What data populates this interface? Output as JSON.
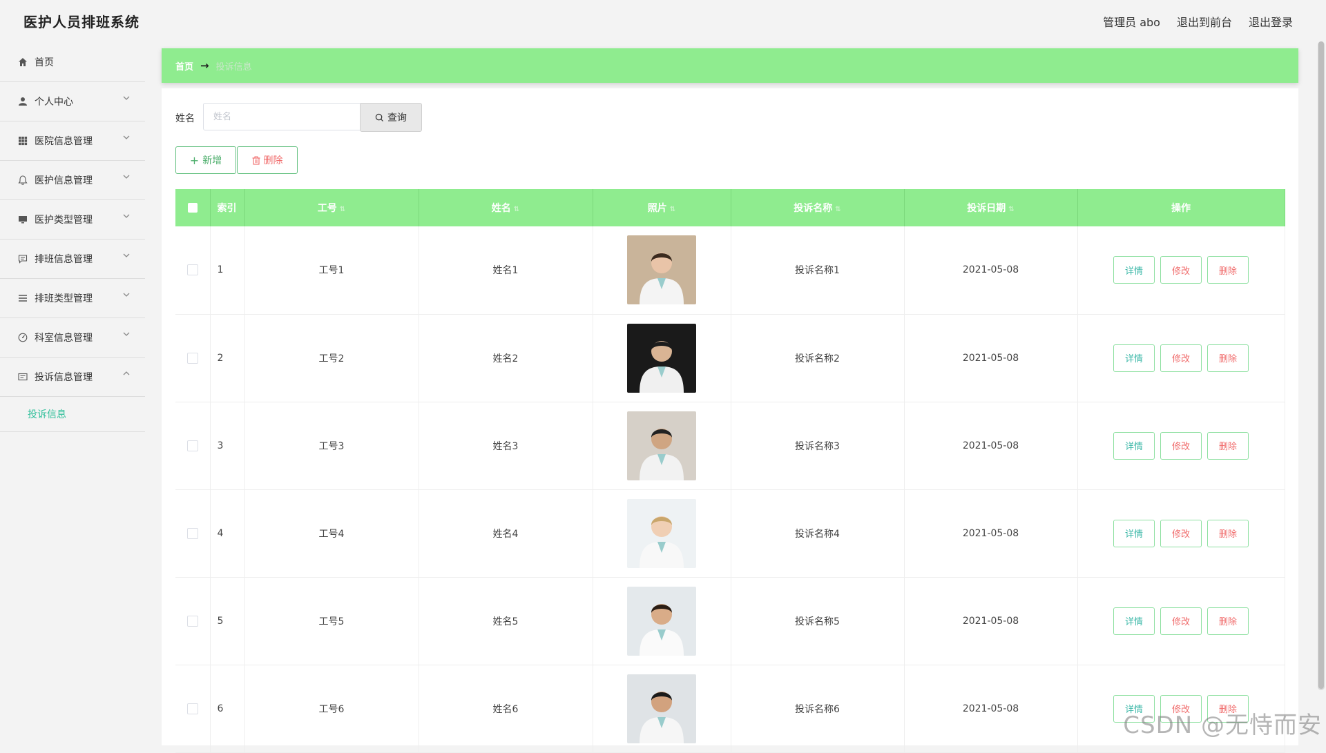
{
  "app": {
    "title": "医护人员排班系统",
    "top_links": [
      "管理员 abo",
      "退出到前台",
      "退出登录"
    ]
  },
  "sidebar": {
    "items": [
      {
        "label": "首页",
        "icon": "home-icon",
        "expandable": false
      },
      {
        "label": "个人中心",
        "icon": "user-icon",
        "expandable": true
      },
      {
        "label": "医院信息管理",
        "icon": "grid-icon",
        "expandable": true
      },
      {
        "label": "医护信息管理",
        "icon": "bell-icon",
        "expandable": true
      },
      {
        "label": "医护类型管理",
        "icon": "monitor-icon",
        "expandable": true
      },
      {
        "label": "排班信息管理",
        "icon": "chat-icon",
        "expandable": true
      },
      {
        "label": "排班类型管理",
        "icon": "list-icon",
        "expandable": true
      },
      {
        "label": "科室信息管理",
        "icon": "dashboard-icon",
        "expandable": true
      },
      {
        "label": "投诉信息管理",
        "icon": "card-icon",
        "expandable": true,
        "expanded": true
      }
    ],
    "submenu": {
      "label": "投诉信息"
    }
  },
  "breadcrumb": {
    "home": "首页",
    "current": "投诉信息"
  },
  "search": {
    "label": "姓名",
    "placeholder": "姓名",
    "value": "",
    "query_label": "查询"
  },
  "actions": {
    "add_label": "新增",
    "delete_label": "删除"
  },
  "table": {
    "columns": [
      "索引",
      "工号",
      "姓名",
      "照片",
      "投诉名称",
      "投诉日期",
      "操作"
    ],
    "sortable": [
      false,
      true,
      true,
      true,
      true,
      true,
      false
    ],
    "row_actions": [
      "详情",
      "修改",
      "删除"
    ],
    "rows": [
      {
        "index": "1",
        "job_no": "工号1",
        "name": "姓名1",
        "photo": "doctor-photo-1",
        "complaint": "投诉名称1",
        "date": "2021-05-08"
      },
      {
        "index": "2",
        "job_no": "工号2",
        "name": "姓名2",
        "photo": "doctor-photo-2",
        "complaint": "投诉名称2",
        "date": "2021-05-08"
      },
      {
        "index": "3",
        "job_no": "工号3",
        "name": "姓名3",
        "photo": "doctor-photo-3",
        "complaint": "投诉名称3",
        "date": "2021-05-08"
      },
      {
        "index": "4",
        "job_no": "工号4",
        "name": "姓名4",
        "photo": "doctor-photo-4",
        "complaint": "投诉名称4",
        "date": "2021-05-08"
      },
      {
        "index": "5",
        "job_no": "工号5",
        "name": "姓名5",
        "photo": "doctor-photo-5",
        "complaint": "投诉名称5",
        "date": "2021-05-08"
      },
      {
        "index": "6",
        "job_no": "工号6",
        "name": "姓名6",
        "photo": "doctor-photo-6",
        "complaint": "投诉名称6",
        "date": "2021-05-08"
      }
    ]
  },
  "watermark": "CSDN @无恃而安",
  "colors": {
    "accent_green": "#8fec8f",
    "button_border": "#62c07f",
    "danger_text": "#f06a6a",
    "detail_text": "#3cb8a8",
    "sidebar_active": "#2fbf9a"
  }
}
